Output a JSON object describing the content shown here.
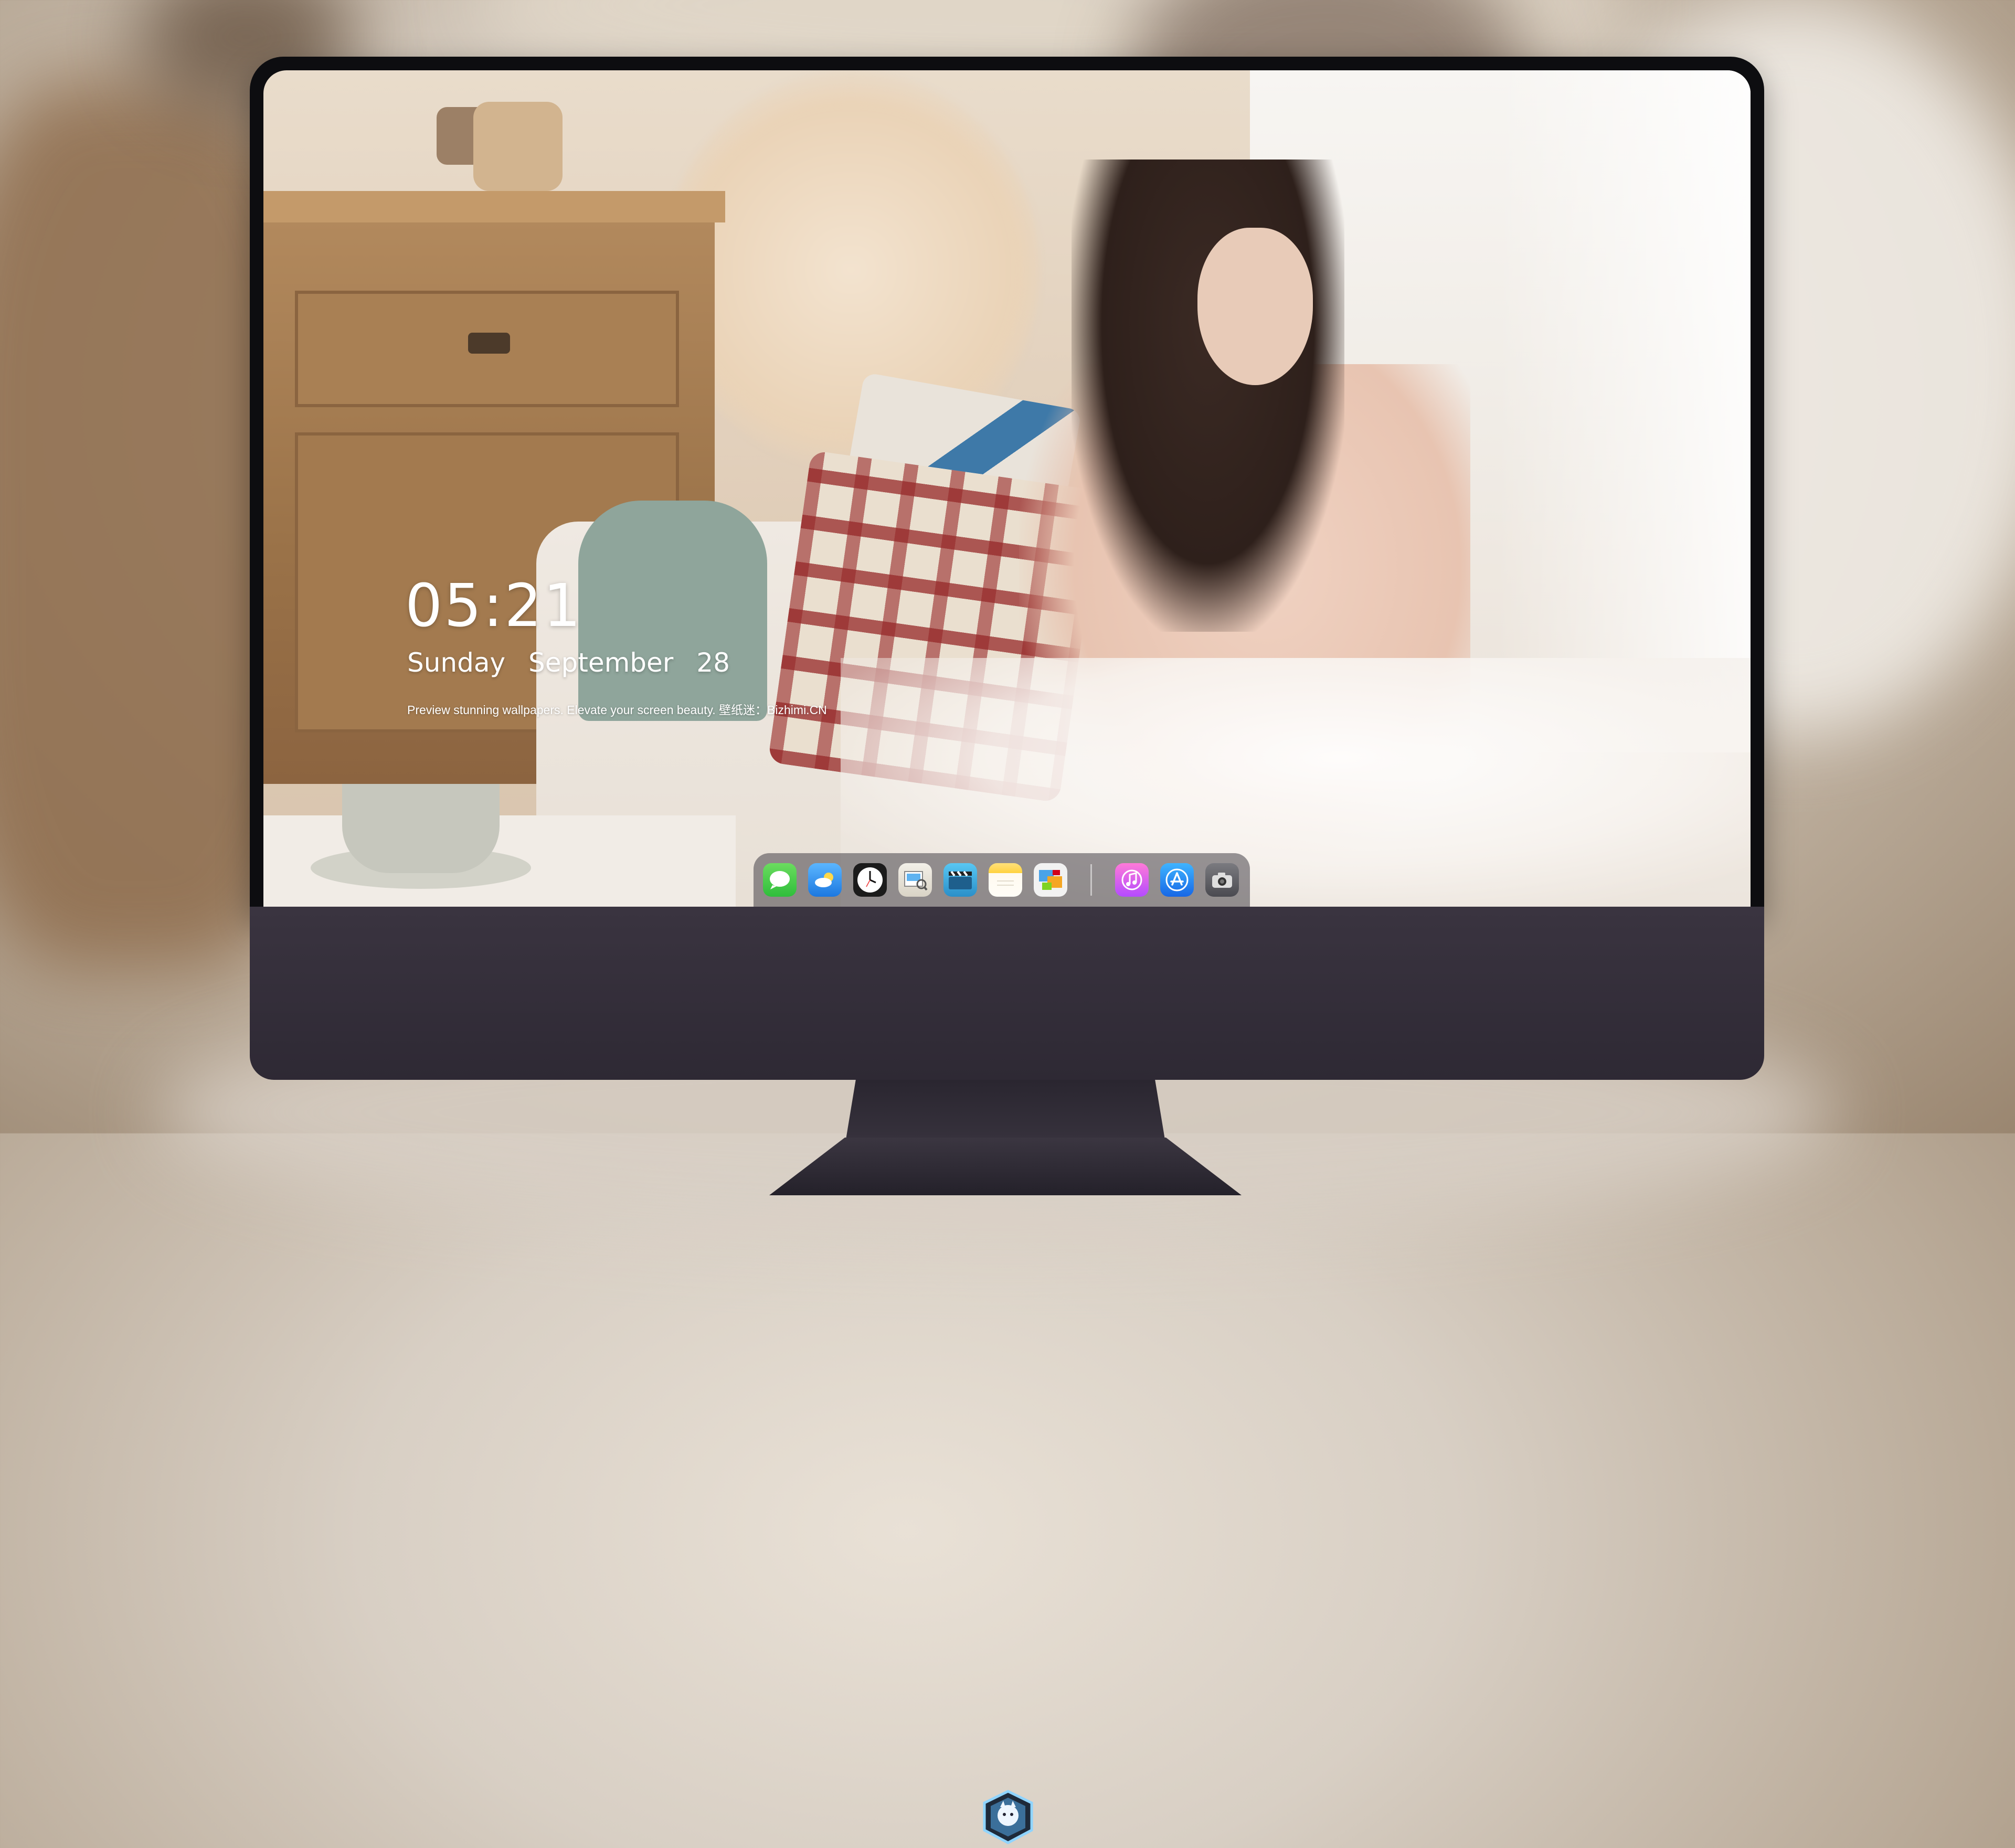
{
  "lockscreen": {
    "time": "05:21",
    "weekday": "Sunday",
    "month": "September",
    "day": "28",
    "tagline": "Preview stunning wallpapers. Elevate your screen beauty. 壁纸迷：Bizhimi.CN"
  },
  "dock": {
    "apps": [
      {
        "icon": "messages-icon",
        "label": "Messages"
      },
      {
        "icon": "weather-icon",
        "label": "Weather"
      },
      {
        "icon": "clock-icon",
        "label": "Clock"
      },
      {
        "icon": "preview-icon",
        "label": "Preview"
      },
      {
        "icon": "movie-clapper-icon",
        "label": "Movie"
      },
      {
        "icon": "notes-icon",
        "label": "Notes"
      },
      {
        "icon": "photo-gallery-icon",
        "label": "Photos"
      },
      {
        "icon": "music-icon",
        "label": "Music"
      },
      {
        "icon": "app-store-icon",
        "label": "App Store"
      },
      {
        "icon": "camera-icon",
        "label": "Camera"
      }
    ]
  },
  "colors": {
    "monitor_bezel": "#0d0d10",
    "monitor_chin": "#3a3440",
    "dock_background": "rgba(70,66,72,.55)",
    "text": "#ffffff"
  }
}
